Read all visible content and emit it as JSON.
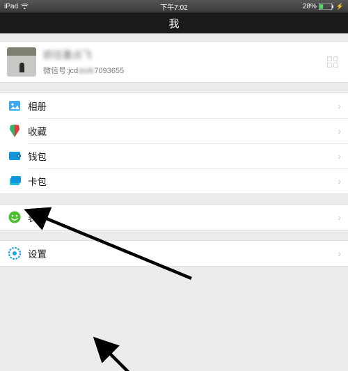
{
  "status_bar": {
    "device": "iPad",
    "time": "下午7:02",
    "battery_pct": "28%"
  },
  "nav_title": "我",
  "profile": {
    "nickname": "抓住重点飞",
    "wxid_label": "微信号: ",
    "wxid_prefix": "jcd",
    "wxid_mid": "dsdk",
    "wxid_suffix": "7093655"
  },
  "menu": {
    "group1": [
      {
        "label": "相册"
      },
      {
        "label": "收藏"
      },
      {
        "label": "钱包"
      },
      {
        "label": "卡包"
      }
    ],
    "group2": [
      {
        "label": "表情"
      }
    ],
    "group3": [
      {
        "label": "设置"
      }
    ]
  }
}
